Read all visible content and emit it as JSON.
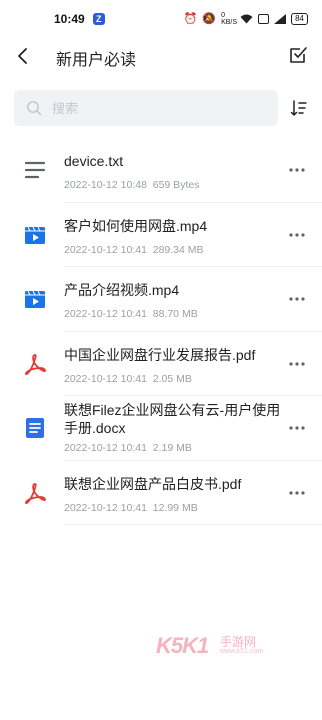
{
  "status_bar": {
    "time": "10:49",
    "app_badge": "Z",
    "net_speed": "0 KB/S",
    "battery": "84"
  },
  "header": {
    "title": "新用户必读"
  },
  "search": {
    "placeholder": "搜索"
  },
  "files": [
    {
      "name": "device.txt",
      "date": "2022-10-12 10:48",
      "size": "659 Bytes",
      "icon": "text-file-icon"
    },
    {
      "name": "客户如何使用网盘.mp4",
      "date": "2022-10-12 10:41",
      "size": "289.34 MB",
      "icon": "video-file-icon"
    },
    {
      "name": "产品介绍视频.mp4",
      "date": "2022-10-12 10:41",
      "size": "88.70 MB",
      "icon": "video-file-icon"
    },
    {
      "name": "中国企业网盘行业发展报告.pdf",
      "date": "2022-10-12 10:41",
      "size": "2.05 MB",
      "icon": "pdf-file-icon"
    },
    {
      "name": "联想Filez企业网盘公有云-用户使用手册.docx",
      "date": "2022-10-12 10:41",
      "size": "2.19 MB",
      "icon": "doc-file-icon"
    },
    {
      "name": "联想企业网盘产品白皮书.pdf",
      "date": "2022-10-12 10:41",
      "size": "12.99 MB",
      "icon": "pdf-file-icon"
    }
  ],
  "watermark": {
    "brand": "K5K1",
    "sub": "手游网",
    "url": "www.k51.com"
  },
  "colors": {
    "video_blue": "#1a73e8",
    "pdf_red": "#e53935",
    "doc_blue": "#2f6fe4",
    "text_gray": "#5f6368",
    "meta_gray": "#9aa0a6"
  }
}
